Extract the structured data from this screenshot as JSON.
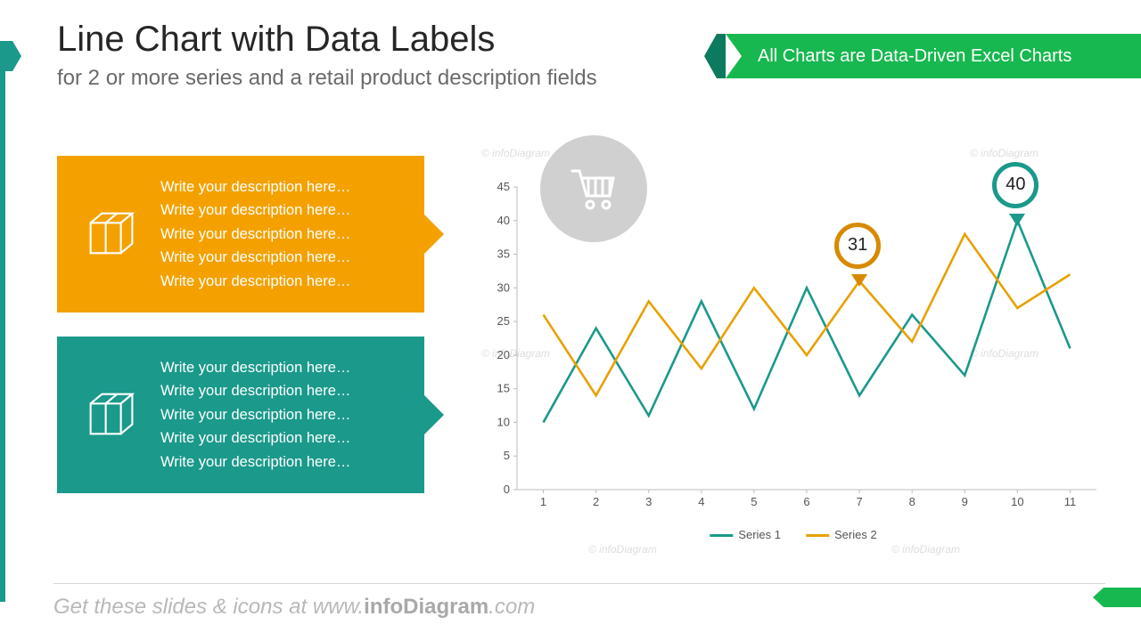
{
  "header": {
    "title": "Line Chart with Data Labels",
    "subtitle": "for 2 or more series and a retail product description fields",
    "ribbon": "All Charts are Data-Driven Excel Charts"
  },
  "cards": {
    "orange": {
      "line1": "Write your description here…",
      "line2": "Write your description here…",
      "line3": "Write your description here…",
      "line4": "Write your description here…",
      "line5": "Write your description here…"
    },
    "teal": {
      "line1": "Write your description here…",
      "line2": "Write your description here…",
      "line3": "Write your description here…",
      "line4": "Write your description here…",
      "line5": "Write your description here…"
    }
  },
  "legend": {
    "s1": "Series 1",
    "s2": "Series 2"
  },
  "callouts": {
    "pin_orange": "31",
    "pin_teal": "40"
  },
  "footer": {
    "text_pre": "Get these slides & icons at www.",
    "text_bold": "infoDiagram",
    "text_post": ".com"
  },
  "watermark": "© infoDiagram",
  "chart_data": {
    "type": "line",
    "categories": [
      "1",
      "2",
      "3",
      "4",
      "5",
      "6",
      "7",
      "8",
      "9",
      "10",
      "11"
    ],
    "series": [
      {
        "name": "Series 1",
        "values": [
          10,
          24,
          11,
          28,
          12,
          30,
          14,
          26,
          17,
          40,
          21
        ]
      },
      {
        "name": "Series 2",
        "values": [
          26,
          14,
          28,
          18,
          30,
          20,
          31,
          22,
          38,
          27,
          32
        ]
      }
    ],
    "xlabel": "",
    "ylabel": "",
    "ylim": [
      0,
      45
    ],
    "y_ticks": [
      0,
      5,
      10,
      15,
      20,
      25,
      30,
      35,
      40,
      45
    ],
    "callouts": [
      {
        "series": "Series 2",
        "x_index": 6,
        "value": 31
      },
      {
        "series": "Series 1",
        "x_index": 9,
        "value": 40
      }
    ],
    "title": ""
  }
}
